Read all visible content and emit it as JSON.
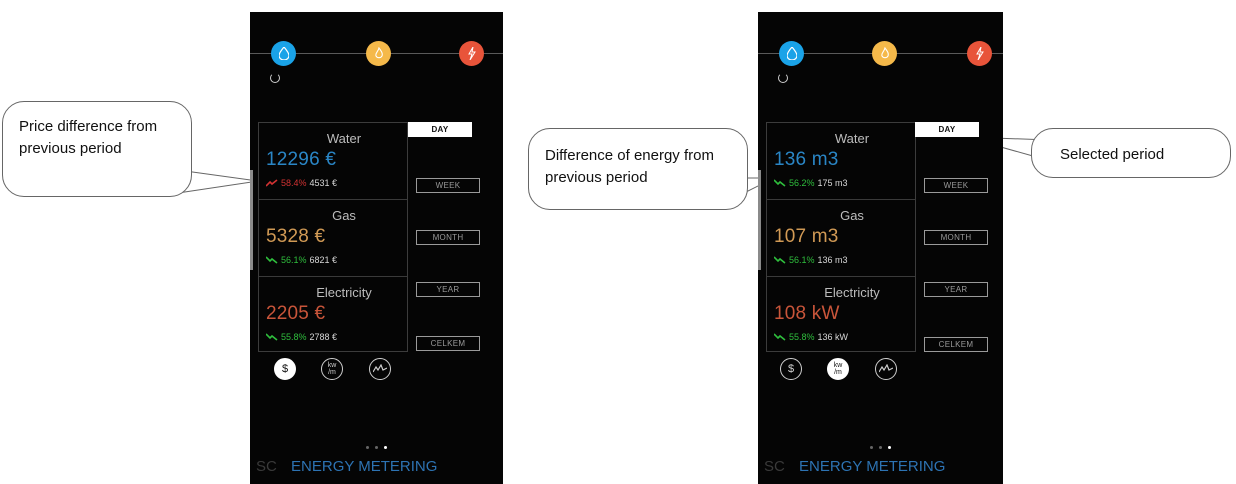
{
  "callouts": {
    "price_difference": "Price difference from previous period",
    "energy_difference": "Difference of energy from previous period",
    "selected_period": "Selected period"
  },
  "colors": {
    "water": "#2a86c6",
    "gas": "#d19a55",
    "electricity": "#c9553a",
    "trend_up": "#d23232",
    "trend_down": "#2fbf3d",
    "header_water": "#1aa3e8",
    "header_gas": "#f5b94a",
    "header_electricity": "#e8543a"
  },
  "header_icons": [
    "water-drop-icon",
    "flame-icon",
    "lightning-icon"
  ],
  "period_options": [
    "DAY",
    "WEEK",
    "MONTH",
    "YEAR",
    "CELKEM"
  ],
  "unit_icons": [
    "dollar-icon",
    "kw-per-m-icon",
    "wave-chart-icon"
  ],
  "footer": {
    "sc": "SC",
    "title": "ENERGY METERING"
  },
  "screens": [
    {
      "selected_period": "DAY",
      "selected_unit": "dollar-icon",
      "meters": [
        {
          "name": "Water",
          "value": "12296 €",
          "trend": "up",
          "percent": "58.4%",
          "previous": "4531 €"
        },
        {
          "name": "Gas",
          "value": "5328 €",
          "trend": "down",
          "percent": "56.1%",
          "previous": "6821 €"
        },
        {
          "name": "Electricity",
          "value": "2205 €",
          "trend": "down",
          "percent": "55.8%",
          "previous": "2788 €"
        }
      ]
    },
    {
      "selected_period": "DAY",
      "selected_unit": "kw-per-m-icon",
      "meters": [
        {
          "name": "Water",
          "value": "136 m3",
          "trend": "down",
          "percent": "56.2%",
          "previous": "175 m3"
        },
        {
          "name": "Gas",
          "value": "107 m3",
          "trend": "down",
          "percent": "56.1%",
          "previous": "136 m3"
        },
        {
          "name": "Electricity",
          "value": "108 kW",
          "trend": "down",
          "percent": "55.8%",
          "previous": "136 kW"
        }
      ]
    }
  ]
}
